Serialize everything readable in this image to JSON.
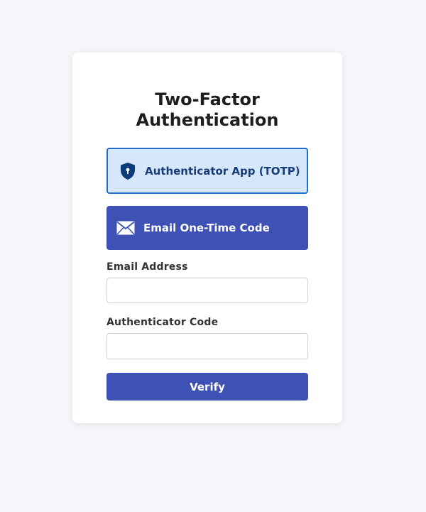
{
  "card": {
    "title": "Two-Factor Authentication"
  },
  "methods": [
    {
      "label": "Authenticator App (TOTP)",
      "icon": "shield-lock-icon",
      "selected": true
    },
    {
      "label": "Email One-Time Code",
      "icon": "envelope-icon",
      "selected": false
    }
  ],
  "fields": {
    "email": {
      "label": "Email Address",
      "value": "",
      "placeholder": ""
    },
    "code": {
      "label": "Authenticator Code",
      "value": "",
      "placeholder": ""
    }
  },
  "actions": {
    "verify_label": "Verify"
  },
  "colors": {
    "page_bg": "#f5f6fa",
    "card_bg": "#ffffff",
    "primary": "#3e51b5",
    "selected_bg": "#d7e7fb",
    "selected_border": "#1f6fd1",
    "selected_text": "#173d78",
    "icon_dark": "#0d3c7a"
  }
}
